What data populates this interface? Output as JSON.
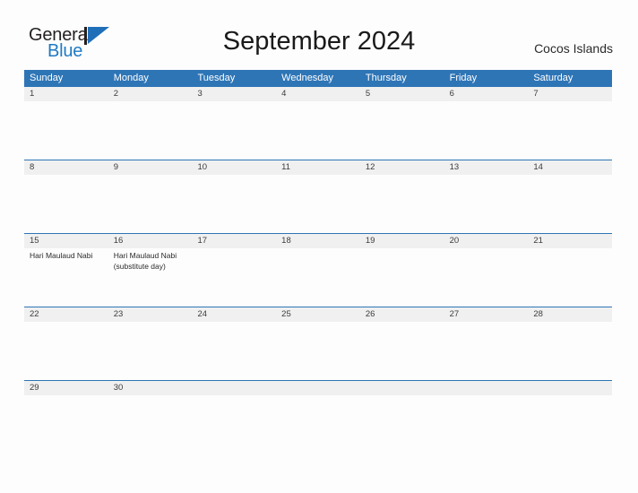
{
  "brand": {
    "name_part1": "General",
    "name_part2": "Blue",
    "flag_icon": "pennant-flag-icon",
    "color_dark": "#231f20",
    "color_blue": "#1f7ac4"
  },
  "header": {
    "title": "September 2024",
    "location": "Cocos Islands"
  },
  "theme": {
    "header_blue": "#2e75b6",
    "date_band_gray": "#f0f0f0",
    "page_background": "#fdfdfd",
    "text_color": "#2b2b2b"
  },
  "weekdays": [
    "Sunday",
    "Monday",
    "Tuesday",
    "Wednesday",
    "Thursday",
    "Friday",
    "Saturday"
  ],
  "weeks": [
    {
      "days": [
        {
          "date": "1",
          "events": []
        },
        {
          "date": "2",
          "events": []
        },
        {
          "date": "3",
          "events": []
        },
        {
          "date": "4",
          "events": []
        },
        {
          "date": "5",
          "events": []
        },
        {
          "date": "6",
          "events": []
        },
        {
          "date": "7",
          "events": []
        }
      ]
    },
    {
      "days": [
        {
          "date": "8",
          "events": []
        },
        {
          "date": "9",
          "events": []
        },
        {
          "date": "10",
          "events": []
        },
        {
          "date": "11",
          "events": []
        },
        {
          "date": "12",
          "events": []
        },
        {
          "date": "13",
          "events": []
        },
        {
          "date": "14",
          "events": []
        }
      ]
    },
    {
      "days": [
        {
          "date": "15",
          "events": [
            "Hari Maulaud Nabi"
          ]
        },
        {
          "date": "16",
          "events": [
            "Hari Maulaud Nabi (substitute day)"
          ]
        },
        {
          "date": "17",
          "events": []
        },
        {
          "date": "18",
          "events": []
        },
        {
          "date": "19",
          "events": []
        },
        {
          "date": "20",
          "events": []
        },
        {
          "date": "21",
          "events": []
        }
      ]
    },
    {
      "days": [
        {
          "date": "22",
          "events": []
        },
        {
          "date": "23",
          "events": []
        },
        {
          "date": "24",
          "events": []
        },
        {
          "date": "25",
          "events": []
        },
        {
          "date": "26",
          "events": []
        },
        {
          "date": "27",
          "events": []
        },
        {
          "date": "28",
          "events": []
        }
      ]
    },
    {
      "days": [
        {
          "date": "29",
          "events": []
        },
        {
          "date": "30",
          "events": []
        },
        {
          "date": "",
          "events": []
        },
        {
          "date": "",
          "events": []
        },
        {
          "date": "",
          "events": []
        },
        {
          "date": "",
          "events": []
        },
        {
          "date": "",
          "events": []
        }
      ]
    }
  ]
}
